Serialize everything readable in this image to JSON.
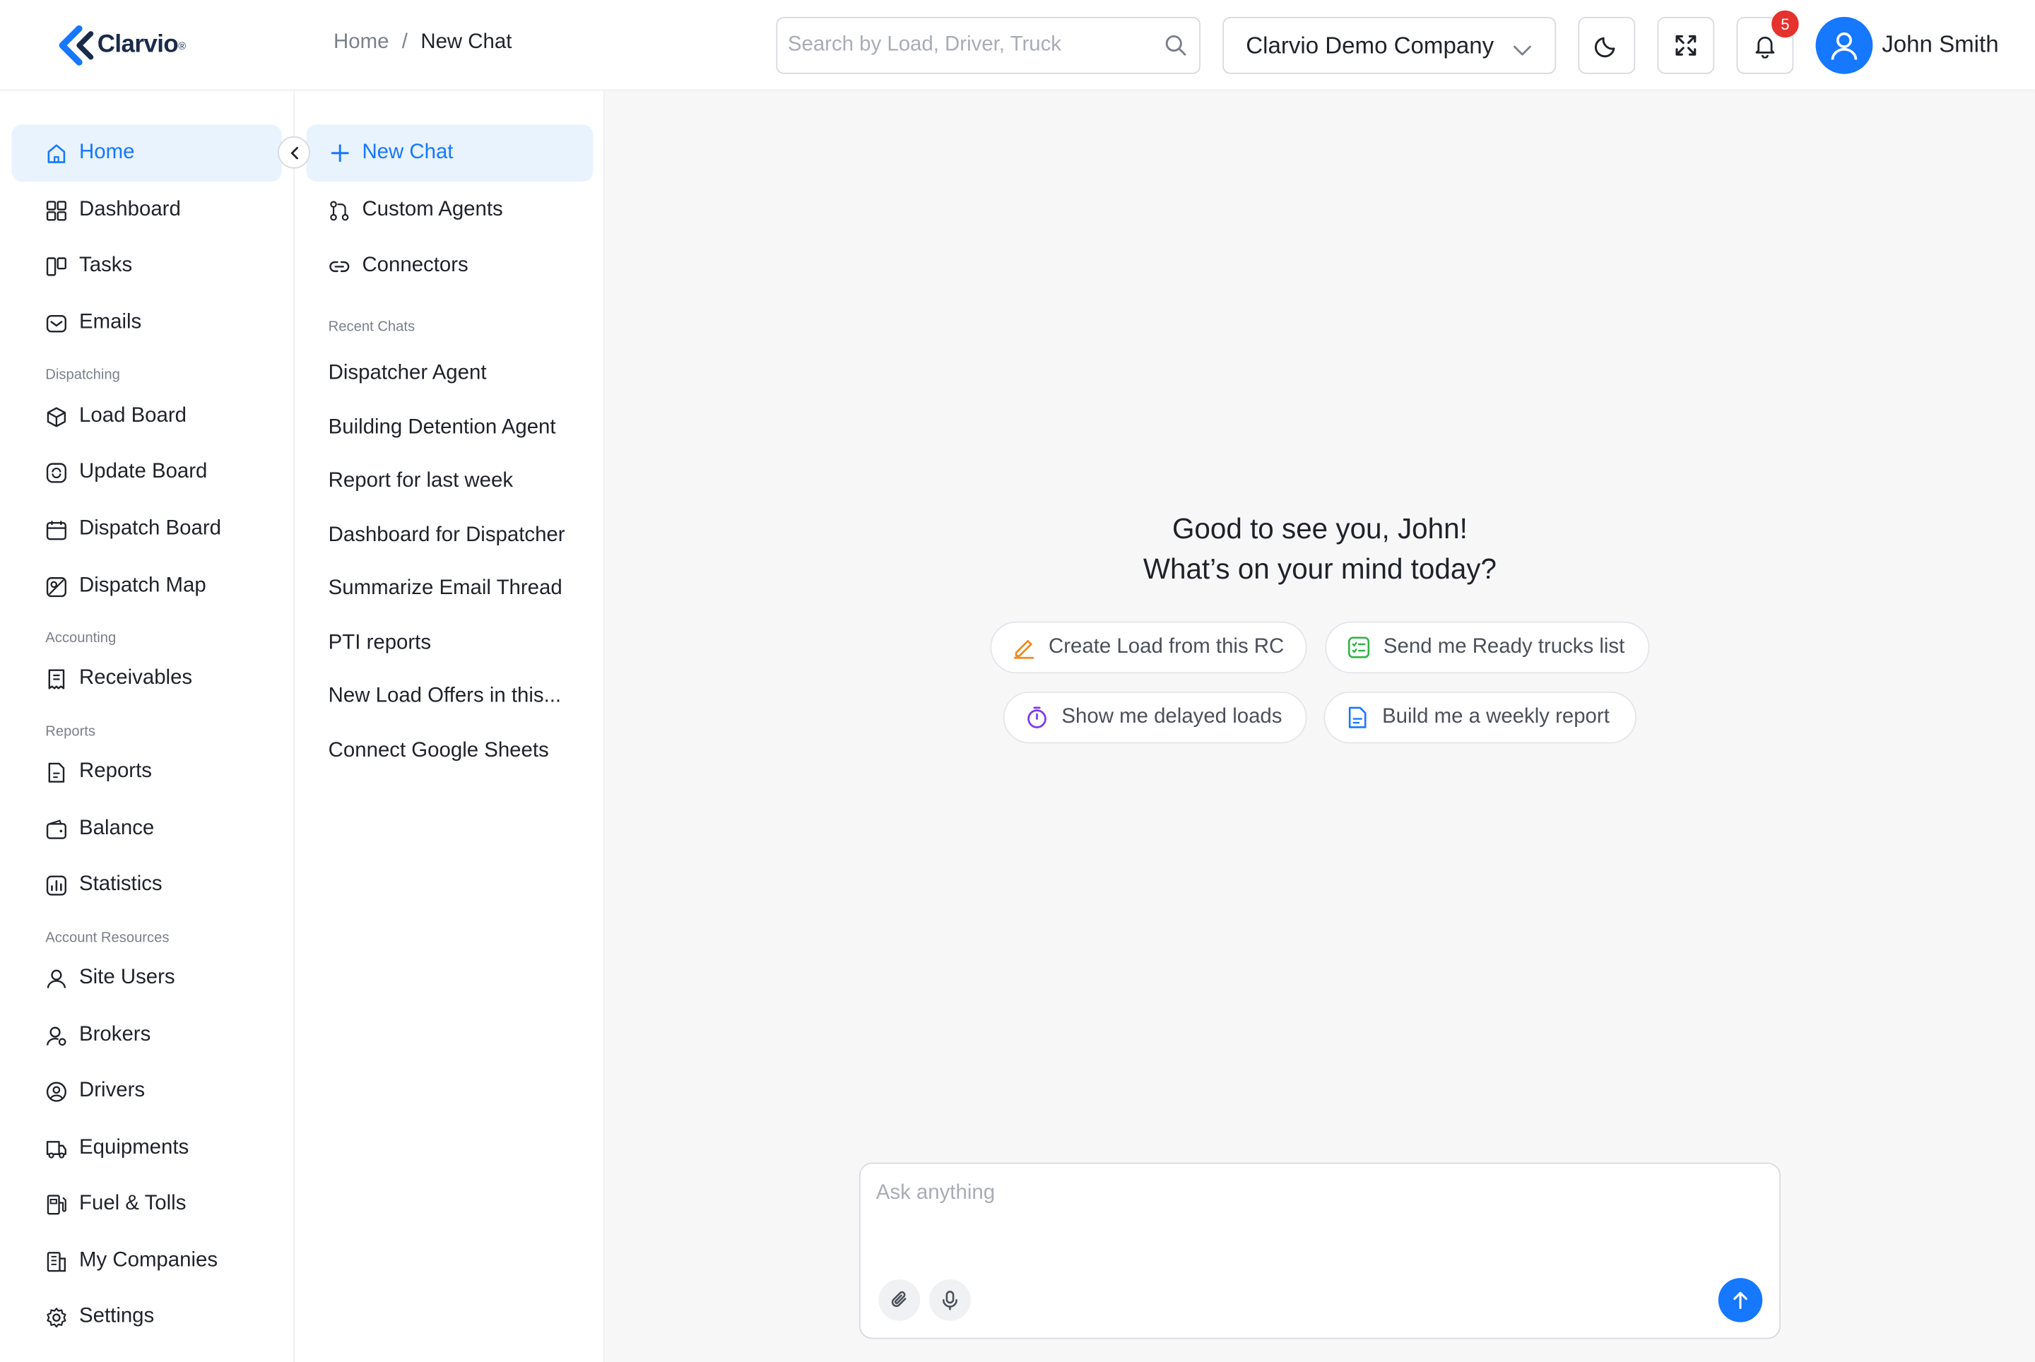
{
  "header": {
    "logo_text": "Clarvio",
    "breadcrumb": {
      "home": "Home",
      "separator": "/",
      "current": "New Chat"
    },
    "search": {
      "placeholder": "Search by Load, Driver, Truck",
      "value": ""
    },
    "company_selector": {
      "selected": "Clarvio Demo Company"
    },
    "notifications": {
      "count": "5"
    },
    "user": {
      "name": "John Smith"
    }
  },
  "sidebar": {
    "items": [
      {
        "label": "Home",
        "icon": "home-icon",
        "active": true
      },
      {
        "label": "Dashboard",
        "icon": "grid-icon"
      },
      {
        "label": "Tasks",
        "icon": "kanban-icon"
      },
      {
        "label": "Emails",
        "icon": "mail-icon"
      }
    ],
    "sections": [
      {
        "title": "Dispatching",
        "items": [
          {
            "label": "Load Board",
            "icon": "box-icon"
          },
          {
            "label": "Update Board",
            "icon": "refresh-icon"
          },
          {
            "label": "Dispatch Board",
            "icon": "calendar-icon"
          },
          {
            "label": "Dispatch Map",
            "icon": "map-icon"
          }
        ]
      },
      {
        "title": "Accounting",
        "items": [
          {
            "label": "Receivables",
            "icon": "receipt-icon"
          }
        ]
      },
      {
        "title": "Reports",
        "items": [
          {
            "label": "Reports",
            "icon": "report-icon"
          },
          {
            "label": "Balance",
            "icon": "wallet-icon"
          },
          {
            "label": "Statistics",
            "icon": "chart-icon"
          }
        ]
      },
      {
        "title": "Account Resources",
        "items": [
          {
            "label": "Site Users",
            "icon": "user-icon"
          },
          {
            "label": "Brokers",
            "icon": "broker-icon"
          },
          {
            "label": "Drivers",
            "icon": "driver-icon"
          },
          {
            "label": "Equipments",
            "icon": "truck-icon"
          },
          {
            "label": "Fuel & Tolls",
            "icon": "fuel-icon"
          },
          {
            "label": "My Companies",
            "icon": "building-icon"
          },
          {
            "label": "Settings",
            "icon": "gear-icon"
          }
        ]
      }
    ]
  },
  "chat_panel": {
    "new_chat": "New Chat",
    "custom_agents": "Custom Agents",
    "connectors": "Connectors",
    "recent_title": "Recent Chats",
    "recent": [
      "Dispatcher Agent",
      "Building Detention Agent",
      "Report for last week",
      "Dashboard for Dispatcher",
      "Summarize Email Thread",
      "PTI reports",
      "New Load Offers in this...",
      "Connect Google Sheets"
    ]
  },
  "main": {
    "greeting_line1": "Good to see you, John!",
    "greeting_line2": "What’s on your mind today?",
    "suggestions": [
      {
        "label": "Create Load from this RC",
        "icon": "pencil-icon",
        "color": "#f08a1c"
      },
      {
        "label": "Send me Ready trucks list",
        "icon": "checklist-icon",
        "color": "#2fb344"
      },
      {
        "label": "Show me delayed loads",
        "icon": "timer-icon",
        "color": "#7c3aed"
      },
      {
        "label": "Build me a weekly report",
        "icon": "document-icon",
        "color": "#1677ff"
      }
    ],
    "composer": {
      "placeholder": "Ask anything",
      "value": ""
    }
  },
  "colors": {
    "accent": "#1677ff",
    "active_bg": "#e8f3fe",
    "badge": "#e5322d"
  }
}
